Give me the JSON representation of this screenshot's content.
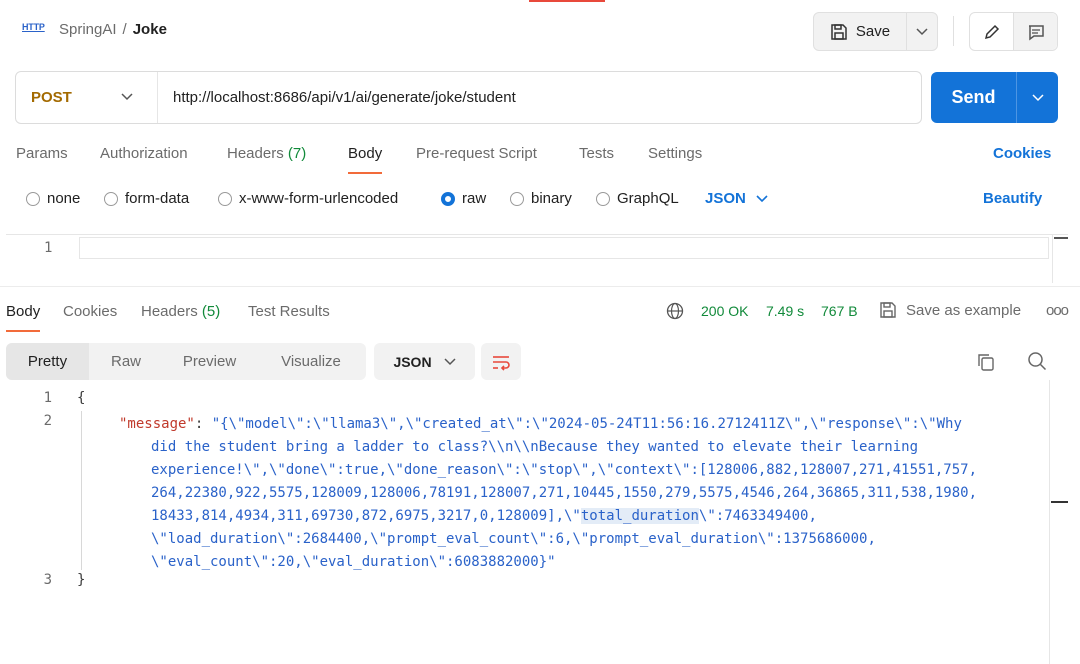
{
  "header": {
    "http_badge": "HTTP",
    "breadcrumb_parent": "SpringAI",
    "breadcrumb_sep": "/",
    "breadcrumb_current": "Joke",
    "save_label": "Save"
  },
  "request": {
    "method": "POST",
    "url": "http://localhost:8686/api/v1/ai/generate/joke/student",
    "send_label": "Send"
  },
  "request_tabs": {
    "params": "Params",
    "authorization": "Authorization",
    "headers": "Headers",
    "headers_count": "(7)",
    "body": "Body",
    "prerequest": "Pre-request Script",
    "tests": "Tests",
    "settings": "Settings",
    "cookies": "Cookies"
  },
  "body_types": {
    "none": "none",
    "form_data": "form-data",
    "urlencoded": "x-www-form-urlencoded",
    "raw": "raw",
    "binary": "binary",
    "graphql": "GraphQL",
    "language": "JSON",
    "beautify": "Beautify",
    "selected": "raw"
  },
  "request_editor": {
    "line_number": "1",
    "content": ""
  },
  "response_tabs": {
    "body": "Body",
    "cookies": "Cookies",
    "headers": "Headers",
    "headers_count": "(5)",
    "test_results": "Test Results"
  },
  "response_meta": {
    "status": "200 OK",
    "time": "7.49 s",
    "size": "767 B",
    "save_example": "Save as example",
    "more": "ooo"
  },
  "response_toolbar": {
    "pretty": "Pretty",
    "raw": "Raw",
    "preview": "Preview",
    "visualize": "Visualize",
    "format": "JSON"
  },
  "response_body": {
    "line_numbers": [
      "1",
      "2",
      "3"
    ],
    "open_brace": "{",
    "close_brace": "}",
    "key": "\"message\"",
    "colon": ": ",
    "value_line_1": "\"{\\\"model\\\":\\\"llama3\\\",\\\"created_at\\\":\\\"2024-05-24T11:56:16.2712411Z\\\",\\\"response\\\":\\\"Why",
    "value_line_2": "did the student bring a ladder to class?\\\\n\\\\nBecause they wanted to elevate their learning",
    "value_line_3": "experience!\\\",\\\"done\\\":true,\\\"done_reason\\\":\\\"stop\\\",\\\"context\\\":[128006,882,128007,271,41551,757,",
    "value_line_4": "264,22380,922,5575,128009,128006,78191,128007,271,10445,1550,279,5575,4546,264,36865,311,538,1980,",
    "value_line_5_a": "18433,814,4934,311,69730,872,6975,3217,0,128009],\\\"",
    "value_line_5_hl": "total_duration",
    "value_line_5_b": "\\\":7463349400,",
    "value_line_6": "\\\"load_duration\\\":2684400,\\\"prompt_eval_count\\\":6,\\\"prompt_eval_duration\\\":1375686000,",
    "value_line_7": "\\\"eval_count\\\":20,\\\"eval_duration\\\":6083882000}\""
  },
  "colors": {
    "accent_blue": "#1373d8",
    "method_post": "#a36a00",
    "status_green": "#118a3a",
    "tab_underline": "#f26b3a",
    "json_key": "#c0392b",
    "json_string": "#2a62c9"
  }
}
